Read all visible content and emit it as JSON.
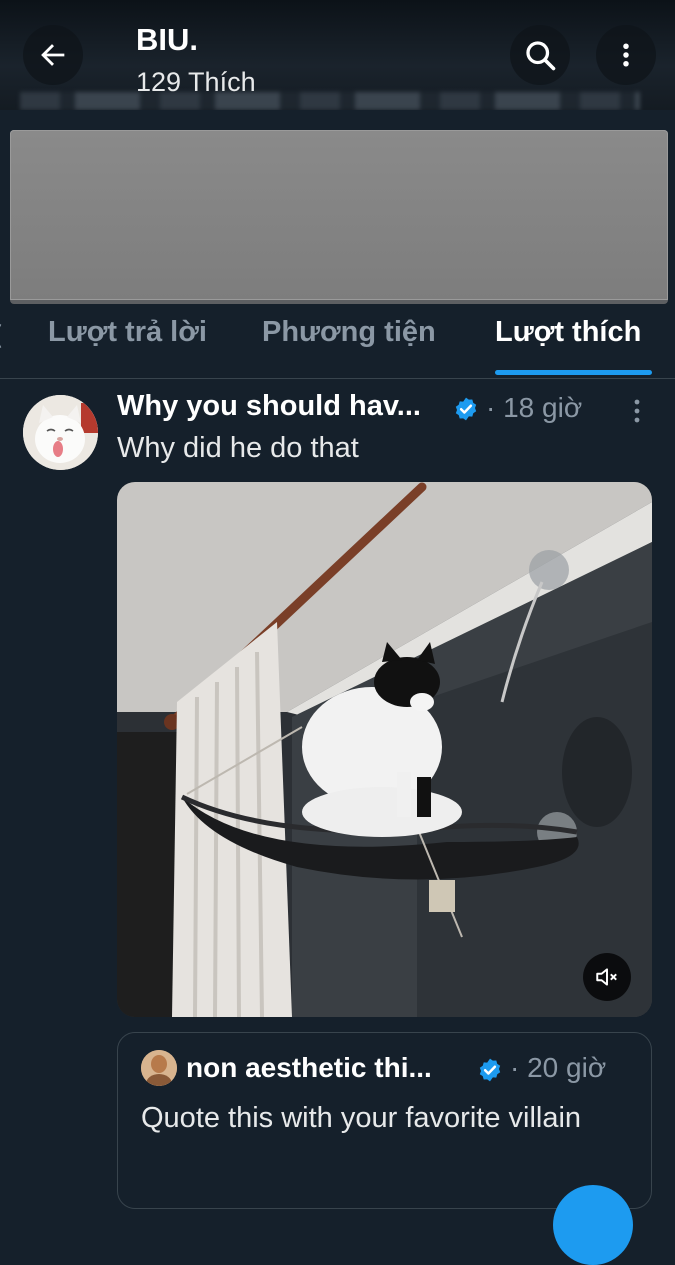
{
  "header": {
    "title": "BIU.",
    "subtitle": "129 Thích",
    "back_icon": "arrow-left-icon",
    "search_icon": "search-icon",
    "more_icon": "more-vertical-icon"
  },
  "tabs": [
    {
      "label": "Lượt trả lời",
      "active": false
    },
    {
      "label": "Phương tiện",
      "active": false
    },
    {
      "label": "Lượt thích",
      "active": true
    }
  ],
  "tweet": {
    "author": "Why you should hav...",
    "verified": true,
    "separator": "·",
    "time": "18 giờ",
    "text": "Why did he do that",
    "media_alt_icon": "video-thumbnail",
    "mute_icon": "speaker-muted-icon"
  },
  "quote": {
    "author": "non aesthetic thi...",
    "verified": true,
    "separator": "·",
    "time": "20 giờ",
    "text": "Quote this with your favorite villain"
  },
  "colors": {
    "background": "#15202b",
    "accent": "#1d9bf0",
    "muted": "#8b98a5",
    "text": "#e7e9ea"
  }
}
